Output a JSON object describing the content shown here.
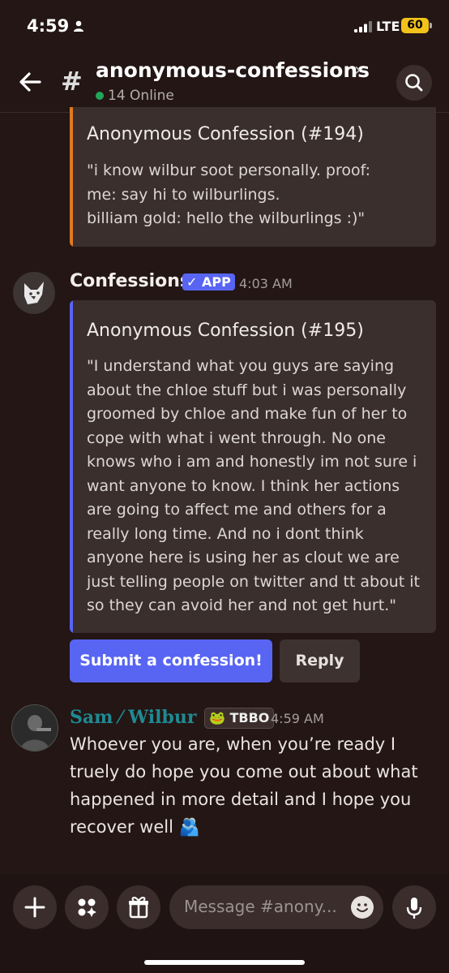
{
  "status_bar": {
    "time": "4:59",
    "network": "LTE",
    "battery": "60"
  },
  "header": {
    "channel_name": "anonymous-confessions",
    "online": "14 Online"
  },
  "embed_194": {
    "title": "Anonymous Confession (#194)",
    "body": "\"i know wilbur soot personally. proof:\nme: say hi to wilburlings.\nbilliam gold: hello the wilburlings :)\""
  },
  "bot_message": {
    "author": "Confessions",
    "badge": "✓ APP",
    "time": "4:03 AM",
    "embed": {
      "title": "Anonymous Confession (#195)",
      "body": "\"I understand what you guys are saying about the chloe stuff but i was personally groomed by chloe and make fun of her to cope with what i went through. No one knows who i am and honestly im not sure i want anyone to know. I think her actions are going to affect me and others for a really long time. And no i dont think anyone here is using her as clout we are just telling people on twitter and tt about it so they can avoid her and not get hurt.\""
    },
    "buttons": {
      "submit": "Submit a confession!",
      "reply": "Reply"
    }
  },
  "user_message": {
    "author": "Sam ⁄ Wilbur",
    "tag": "🐸 TBBO",
    "time": "4:59 AM",
    "text": "Whoever you are, when you’re ready I truely do hope you come out about what happened in more detail and I hope you recover well 🫂"
  },
  "composer": {
    "placeholder": "Message #anony..."
  },
  "colors": {
    "background": "#231614",
    "embed": "#3a2f2d",
    "blurple": "#5865f2",
    "embed_194_bar": "#e07a1f",
    "online": "#23a55a",
    "username_teal": "#1f8a93"
  }
}
